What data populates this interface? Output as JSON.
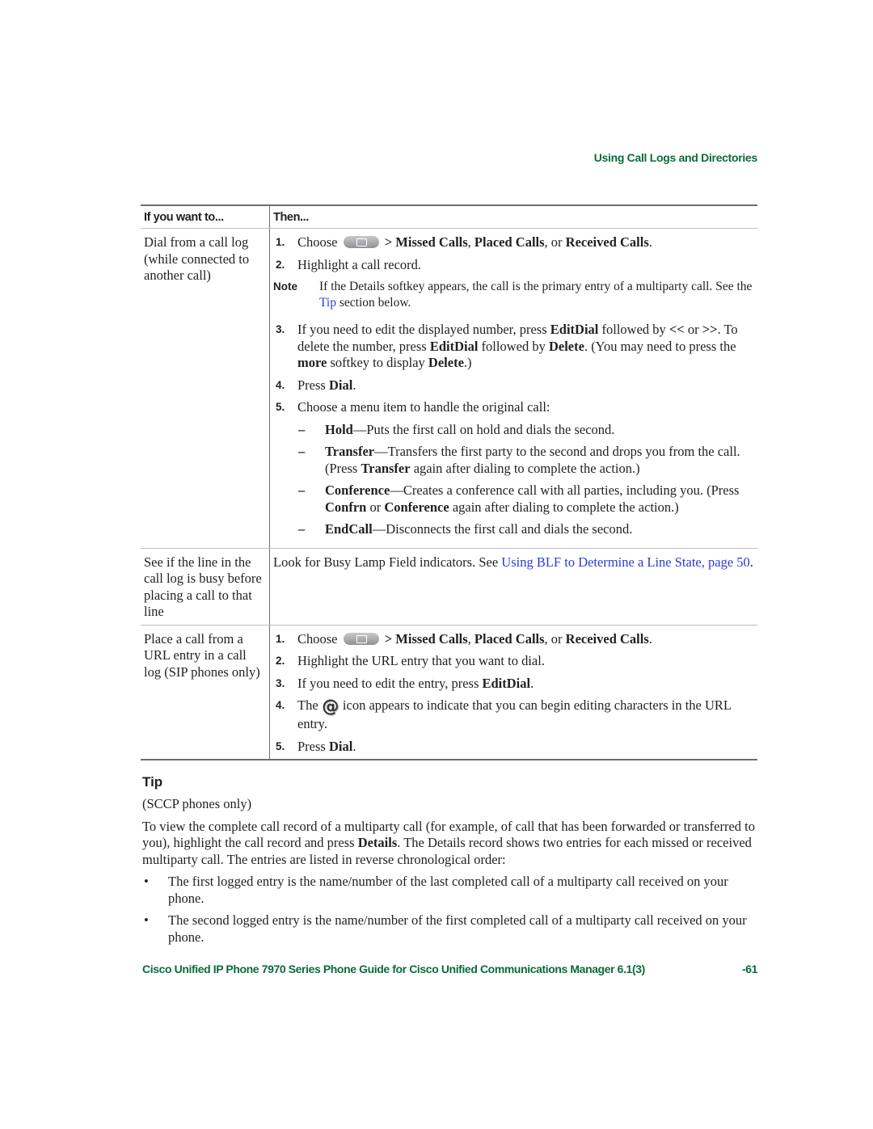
{
  "running_header": "Using Call Logs and Directories",
  "table": {
    "headers": {
      "want": "If you want to...",
      "then": "Then..."
    },
    "rows": [
      {
        "want": "Dial from a call log (while connected to another call)",
        "steps": {
          "s1": {
            "num": "1.",
            "pre": "Choose",
            "icon": "directories-button-icon",
            "post_sep": " > ",
            "opt1": "Missed Calls",
            "c1": ", ",
            "opt2": "Placed Calls",
            "c2": ", or ",
            "opt3": "Received Calls",
            "end": "."
          },
          "s2": {
            "num": "2.",
            "text": "Highlight a call record."
          },
          "note": {
            "label": "Note",
            "pre": "If the Details softkey appears, the call is the primary entry of a multiparty call. See the ",
            "link": "Tip",
            "post": " section below."
          },
          "s3": {
            "num": "3.",
            "t1": "If you need to edit the displayed number, press ",
            "b1": "EditDial",
            "t2": " followed by ",
            "b2": "<<",
            "t3": " or ",
            "b3": ">>",
            "t4": ". To delete the number, press ",
            "b4": "EditDial",
            "t5": " followed by ",
            "b5": "Delete",
            "t6": ". (You may need to press the ",
            "b6": "more",
            "t7": " softkey to display ",
            "b7": "Delete",
            "t8": ".)"
          },
          "s4": {
            "num": "4.",
            "pre": "Press ",
            "bold": "Dial",
            "end": "."
          },
          "s5": {
            "num": "5.",
            "text": "Choose a menu item to handle the original call:"
          },
          "subs": {
            "hold": {
              "dash": "–",
              "bold": "Hold",
              "text": "—Puts the first call on hold and dials the second."
            },
            "transfer": {
              "dash": "–",
              "bold": "Transfer",
              "t1": "—Transfers the first party to the second and drops you from the call. (Press ",
              "b1": "Transfer",
              "t2": " again after dialing to complete the action.)"
            },
            "conference": {
              "dash": "–",
              "bold": "Conference",
              "t1": "—Creates a conference call with all parties, including you. (Press ",
              "b1": "Confrn",
              "t2": " or ",
              "b2": "Conference",
              "t3": " again after dialing to complete the action.)"
            },
            "endcall": {
              "dash": "–",
              "bold": "EndCall",
              "text": "—Disconnects the first call and dials the second."
            }
          }
        }
      },
      {
        "want": "See if the line in the call log is busy before placing a call to that line",
        "pre": "Look for Busy Lamp Field indicators. See ",
        "link": "Using BLF to Determine a Line State, page 50",
        "end": "."
      },
      {
        "want": "Place a call from a URL entry in a call log (SIP phones only)",
        "steps": {
          "s1": {
            "num": "1.",
            "pre": "Choose",
            "post_sep": " > ",
            "opt1": "Missed Calls",
            "c1": ", ",
            "opt2": "Placed Calls",
            "c2": ", or ",
            "opt3": "Received Calls",
            "end": "."
          },
          "s2": {
            "num": "2.",
            "text": "Highlight the URL entry that you want to dial."
          },
          "s3": {
            "num": "3.",
            "pre": "If you need to edit the entry, press ",
            "bold": "EditDial",
            "end": "."
          },
          "s4": {
            "num": "4.",
            "pre": "The ",
            "icon_glyph": "@",
            "post": " icon appears to indicate that you can begin editing characters in the URL entry."
          },
          "s5": {
            "num": "5.",
            "pre": "Press ",
            "bold": "Dial",
            "end": "."
          }
        }
      }
    ]
  },
  "tip": {
    "heading": "Tip",
    "sub": "(SCCP phones only)",
    "para_pre": "To view the complete call record of a multiparty call (for example, of call that has been forwarded or transferred to you), highlight the call record and press ",
    "para_bold": "Details",
    "para_post": ". The Details record shows two entries for each missed or received multiparty call. The entries are listed in reverse chronological order:",
    "bullet_glyph": "•",
    "bullets": [
      "The first logged entry is the name/number of the last completed call of a multiparty call received on your phone.",
      "The second logged entry is the name/number of the first completed call of a multiparty call received on your phone."
    ]
  },
  "footer": {
    "title": "Cisco Unified IP Phone 7970 Series Phone Guide for Cisco Unified Communications Manager 6.1(3)",
    "page": "-61"
  },
  "colors": {
    "accent_green": "#0b6b3a",
    "link_blue": "#2b3bd6"
  }
}
